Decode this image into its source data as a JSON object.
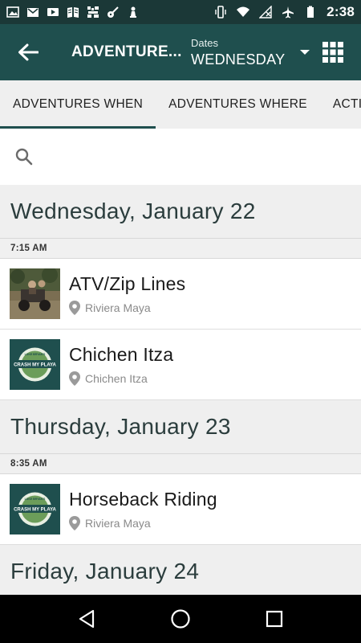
{
  "status_bar": {
    "time": "2:38",
    "icons": [
      "image-icon",
      "gmail-icon",
      "video-icon",
      "book-icon",
      "pixel-app-icon",
      "guitar-icon",
      "chess-piece-icon",
      "vibrate-icon",
      "wifi-icon",
      "no-signal-icon",
      "airplane-icon",
      "battery-icon"
    ]
  },
  "app_bar": {
    "title": "ADVENTURE...",
    "dates_label": "Dates",
    "dates_value": "WEDNESDAY",
    "back_icon": "arrow-left-icon",
    "grid_icon": "grid-icon",
    "bg_color": "#1f4f4e"
  },
  "tabs": [
    {
      "label": "ADVENTURES WHEN",
      "active": true
    },
    {
      "label": "ADVENTURES WHERE",
      "active": false
    },
    {
      "label": "ACTIVITIES",
      "active": false
    }
  ],
  "search": {
    "icon": "search-icon",
    "value": "",
    "placeholder": ""
  },
  "days": [
    {
      "date": "Wednesday, January 22",
      "groups": [
        {
          "time": "7:15 AM",
          "items": [
            {
              "title": "ATV/Zip Lines",
              "location": "Riviera Maya",
              "thumb": "photo"
            },
            {
              "title": "Chichen Itza",
              "location": "Chichen Itza",
              "thumb": "logo"
            }
          ]
        }
      ]
    },
    {
      "date": "Thursday, January 23",
      "groups": [
        {
          "time": "8:35 AM",
          "items": [
            {
              "title": "Horseback Riding",
              "location": "Riviera Maya",
              "thumb": "logo"
            }
          ]
        }
      ]
    },
    {
      "date": "Friday, January 24",
      "groups": []
    }
  ],
  "logo_text": {
    "top": "LUKE BRYAN'S",
    "main": "CRASH MY PLAYA"
  },
  "nav": {
    "back": "nav-back-icon",
    "home": "nav-home-icon",
    "recents": "nav-recents-icon"
  }
}
